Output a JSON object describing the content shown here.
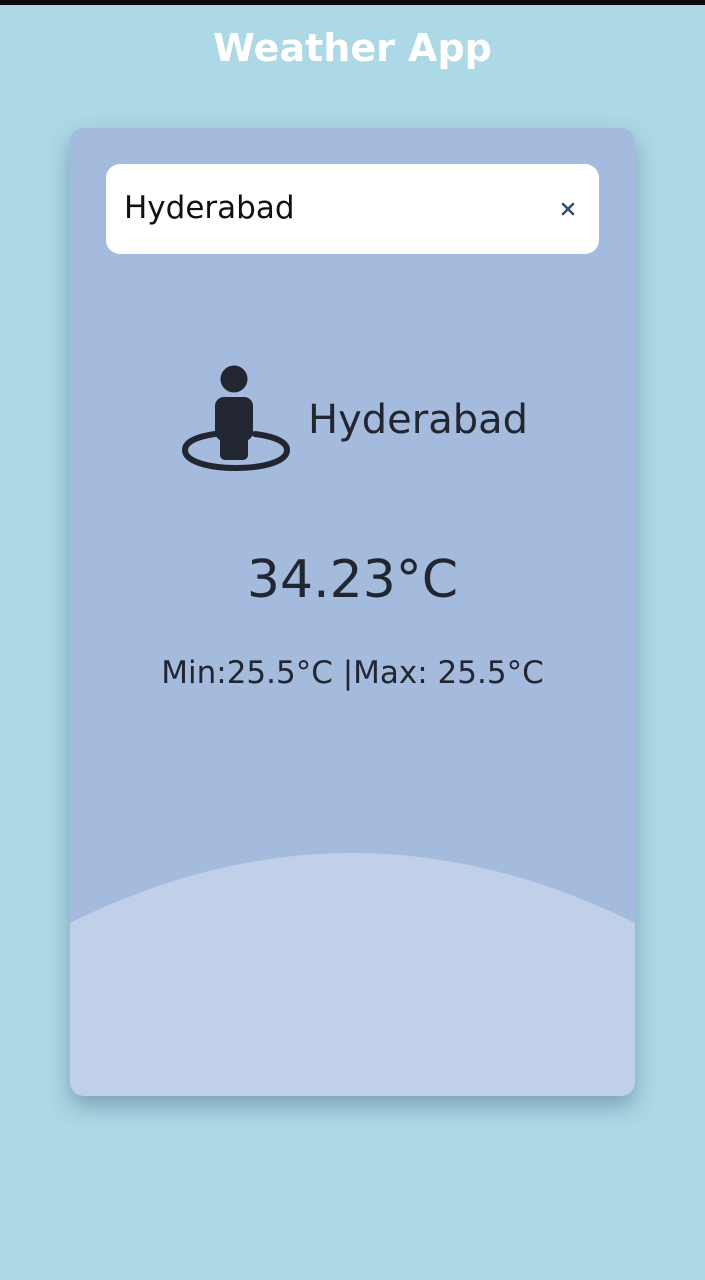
{
  "app": {
    "title": "Weather App"
  },
  "search": {
    "value": "Hyderabad",
    "clear_label": "×"
  },
  "weather": {
    "city": "Hyderabad",
    "temperature": "34.23°C",
    "min_max": "Min:25.5°C |Max: 25.5°C"
  },
  "icons": {
    "location": "street-view-icon",
    "clear": "close-icon"
  },
  "colors": {
    "page_background": "#add8e6",
    "card_background": "#a5bbde",
    "card_wave": "#bfd0e8",
    "title_text": "#ffffff",
    "body_text": "#222630"
  }
}
